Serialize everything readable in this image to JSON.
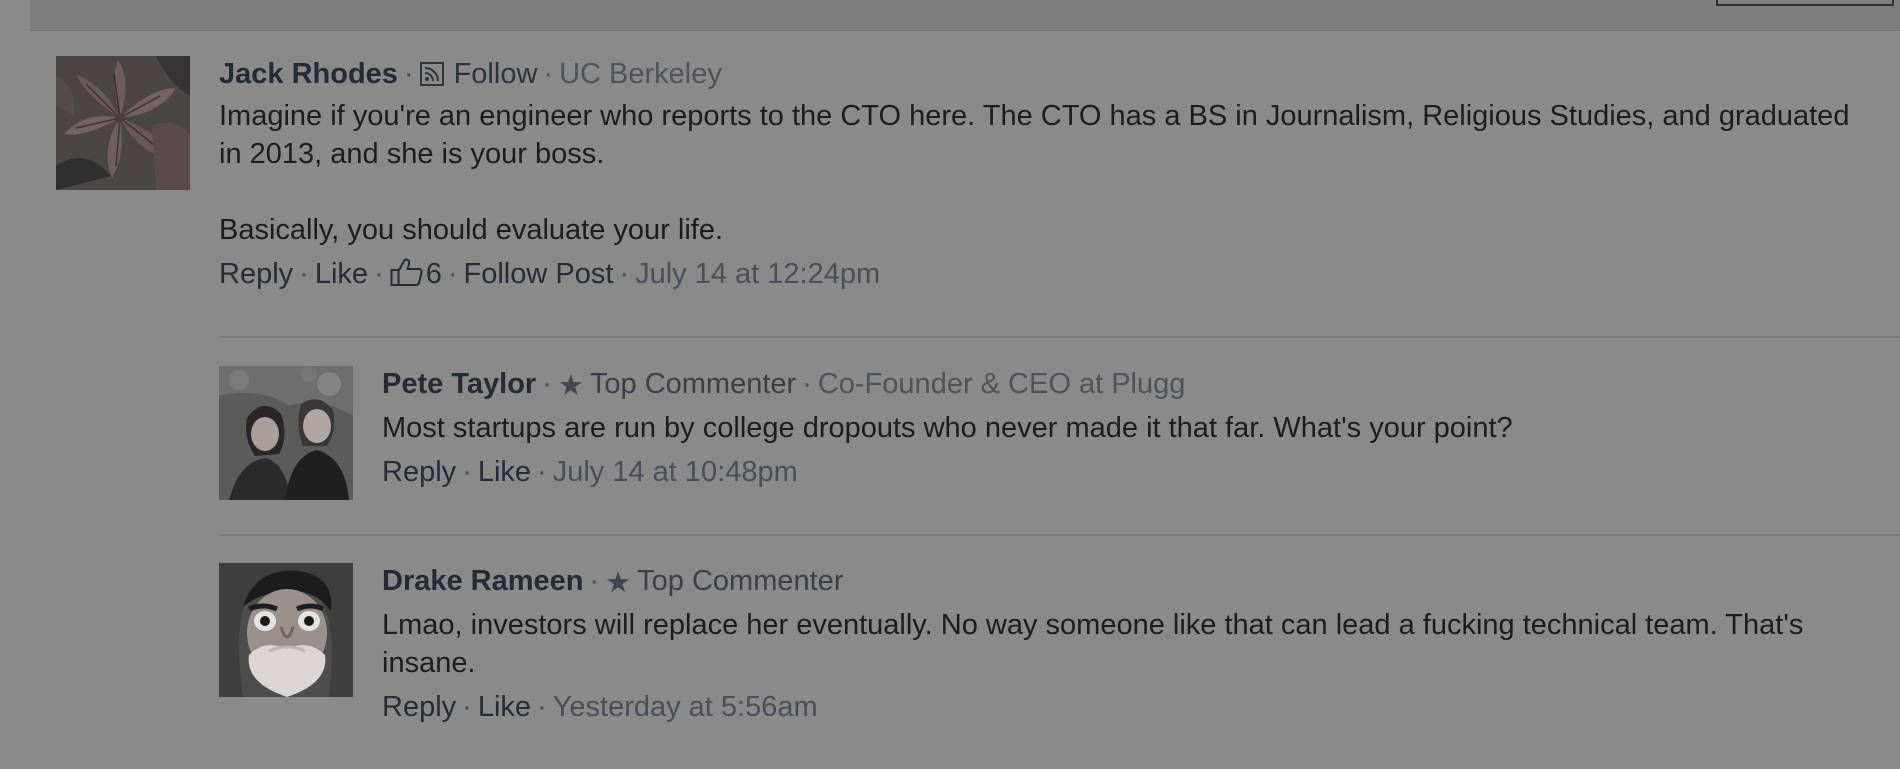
{
  "comments": [
    {
      "author": "Jack Rhodes",
      "follow_label": "Follow",
      "affiliation": "UC Berkeley",
      "paragraphs": [
        "Imagine if you're an engineer who reports to the CTO here. The CTO has a BS in Journalism, Religious Studies, and graduated in 2013, and she is your boss.",
        "Basically, you should evaluate your life."
      ],
      "reply_label": "Reply",
      "like_label": "Like",
      "like_count": "6",
      "follow_post_label": "Follow Post",
      "timestamp": "July 14 at 12:24pm",
      "avatar_icon": "lily-flower-photo"
    },
    {
      "author": "Pete Taylor",
      "badge": "Top Commenter",
      "affiliation": "Co-Founder & CEO at Plugg",
      "paragraphs": [
        "Most startups are run by college dropouts who never made it that far. What's your point?"
      ],
      "reply_label": "Reply",
      "like_label": "Like",
      "timestamp": "July 14 at 10:48pm",
      "avatar_icon": "couple-photo"
    },
    {
      "author": "Drake Rameen",
      "badge": "Top Commenter",
      "paragraphs": [
        "Lmao, investors will replace her eventually. No way someone like that can lead a fucking technical team. That's insane."
      ],
      "reply_label": "Reply",
      "like_label": "Like",
      "timestamp": "Yesterday at 5:56am",
      "avatar_icon": "face-photo"
    }
  ],
  "icons": {
    "rss": "rss-icon",
    "star": "star-icon",
    "thumbs_up": "thumbs-up-icon"
  },
  "colors": {
    "background": "#8a8a8a",
    "author": "#262a35",
    "text": "#1d1d1d",
    "muted": "#4b4e55"
  }
}
